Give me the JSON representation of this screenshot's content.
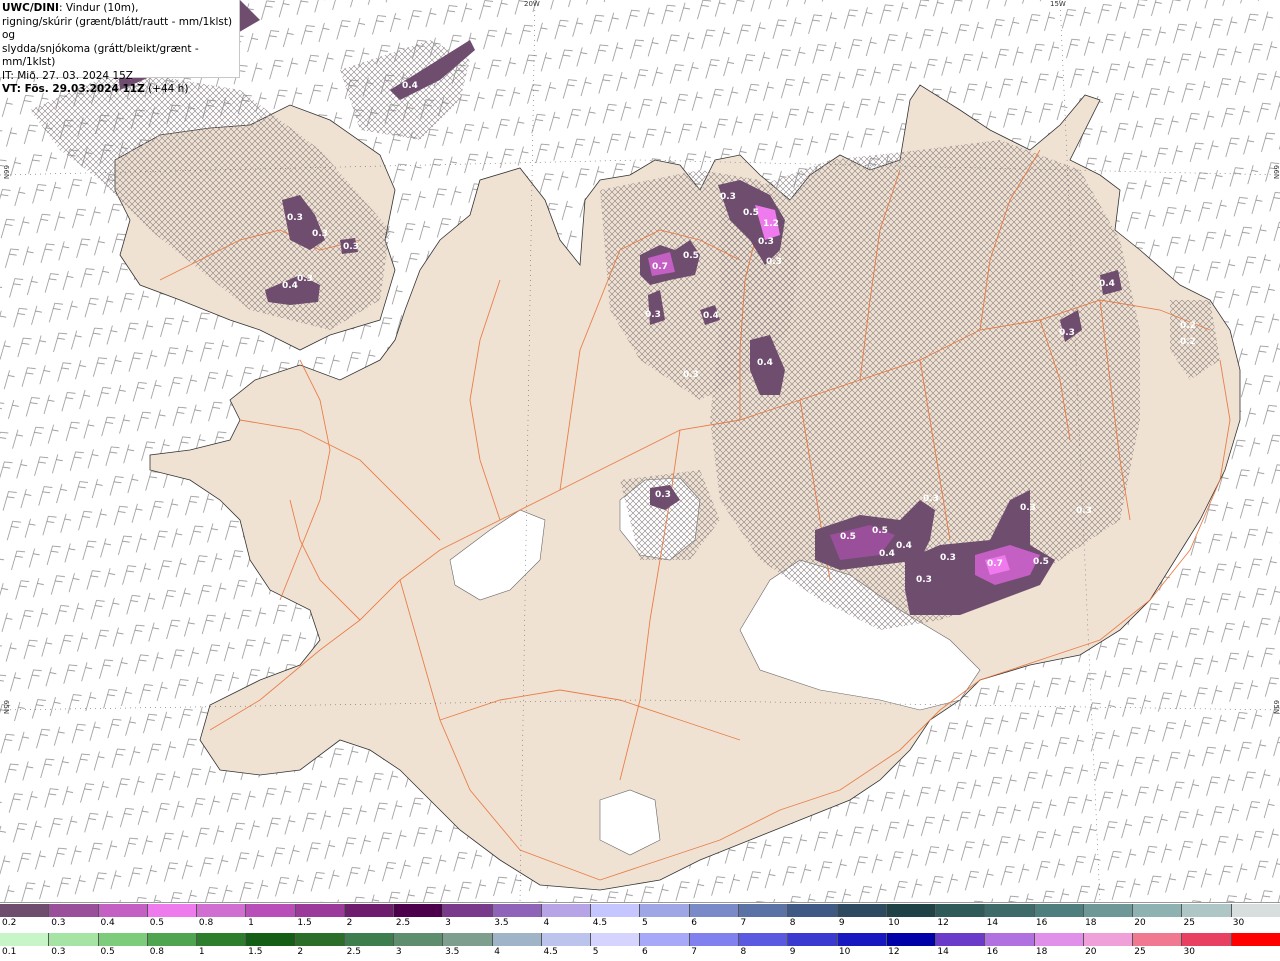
{
  "header": {
    "model": "UWC/DINI",
    "line1_rest": ": Vindur (10m),",
    "line2": "rigning/skúrir (grænt/blátt/rautt - mm/1klst) og",
    "line3": "slydda/snjókoma (grátt/bleikt/grænt - mm/1klst)",
    "line4": "IT: Mið. 27. 03. 2024 15Z",
    "vt_label": "VT: Fös. 29.03.2024 11Z",
    "vt_offset": " (+44 h)"
  },
  "grid_labels": {
    "top_20w": "20W",
    "top_15w": "15W",
    "left_66n": "66N",
    "right_66n": "66N",
    "left_65n": "65N",
    "right_65n": "65N"
  },
  "map_values": [
    {
      "text": "0.4"
    },
    {
      "text": "0.3"
    },
    {
      "text": "0.3"
    },
    {
      "text": "0.3"
    },
    {
      "text": "0.4"
    },
    {
      "text": "0.3"
    },
    {
      "text": "0.7"
    },
    {
      "text": "0.5"
    },
    {
      "text": "0.3"
    },
    {
      "text": "0.4"
    },
    {
      "text": "0.3"
    },
    {
      "text": "0.3"
    },
    {
      "text": "0.5"
    },
    {
      "text": "1.2"
    },
    {
      "text": "0.3"
    },
    {
      "text": "0.4"
    },
    {
      "text": "0.3"
    },
    {
      "text": "0.3"
    },
    {
      "text": "0.4"
    },
    {
      "text": "0.2"
    },
    {
      "text": "0.2"
    },
    {
      "text": "0.3"
    },
    {
      "text": "0.3"
    },
    {
      "text": "0.5"
    },
    {
      "text": "0.5"
    },
    {
      "text": "0.4"
    },
    {
      "text": "0.4"
    },
    {
      "text": "0.3"
    },
    {
      "text": "0.3"
    },
    {
      "text": "0.7"
    },
    {
      "text": "0.5"
    },
    {
      "text": "0.3"
    },
    {
      "text": "0.3"
    }
  ],
  "legend": {
    "snow_labels": [
      "0.2",
      "0.3",
      "0.4",
      "0.5",
      "0.8",
      "1",
      "1.5",
      "2",
      "2.5",
      "3",
      "3.5",
      "4",
      "4.5",
      "5",
      "6",
      "7",
      "8",
      "9",
      "10",
      "12",
      "14",
      "16",
      "18",
      "20",
      "25",
      "30"
    ],
    "snow_colors": [
      "#6e4d6e",
      "#9a4f9a",
      "#c45fc4",
      "#ee7aee",
      "#d16ed1",
      "#b84fb8",
      "#9c3a9c",
      "#6e1c6e",
      "#4c004c",
      "#7a3a8c",
      "#8e63b8",
      "#b7a4e6",
      "#c5c5ff",
      "#9ea6e6",
      "#7a8ac8",
      "#5a72a6",
      "#3e5a84",
      "#2e4a60",
      "#1e4246",
      "#2e5a5a",
      "#3e6a6a",
      "#4e7e7e",
      "#6e9898",
      "#8eb2b2",
      "#aec6c6",
      "#d8dede"
    ],
    "rain_labels": [
      "0.1",
      "0.3",
      "0.5",
      "0.8",
      "1",
      "1.5",
      "2",
      "2.5",
      "3",
      "3.5",
      "4",
      "4.5",
      "5",
      "6",
      "7",
      "8",
      "9",
      "10",
      "12",
      "14",
      "16",
      "18",
      "20",
      "25",
      "30"
    ],
    "rain_colors": [
      "#c8f5c8",
      "#a5e4a5",
      "#7ccc7c",
      "#4fa54f",
      "#2c7e2c",
      "#155e15",
      "#2a6e2a",
      "#3e7e4e",
      "#5e8e6e",
      "#7e9e8e",
      "#a0b4c8",
      "#bcc4ee",
      "#d4d4ff",
      "#a8a8f8",
      "#8080ee",
      "#5a5ae0",
      "#3a3ad0",
      "#1818c0",
      "#0000a8",
      "#6a3ac8",
      "#b070e0",
      "#e090e8",
      "#f0a0d8",
      "#f07890",
      "#e84060",
      "#ff0000"
    ]
  }
}
